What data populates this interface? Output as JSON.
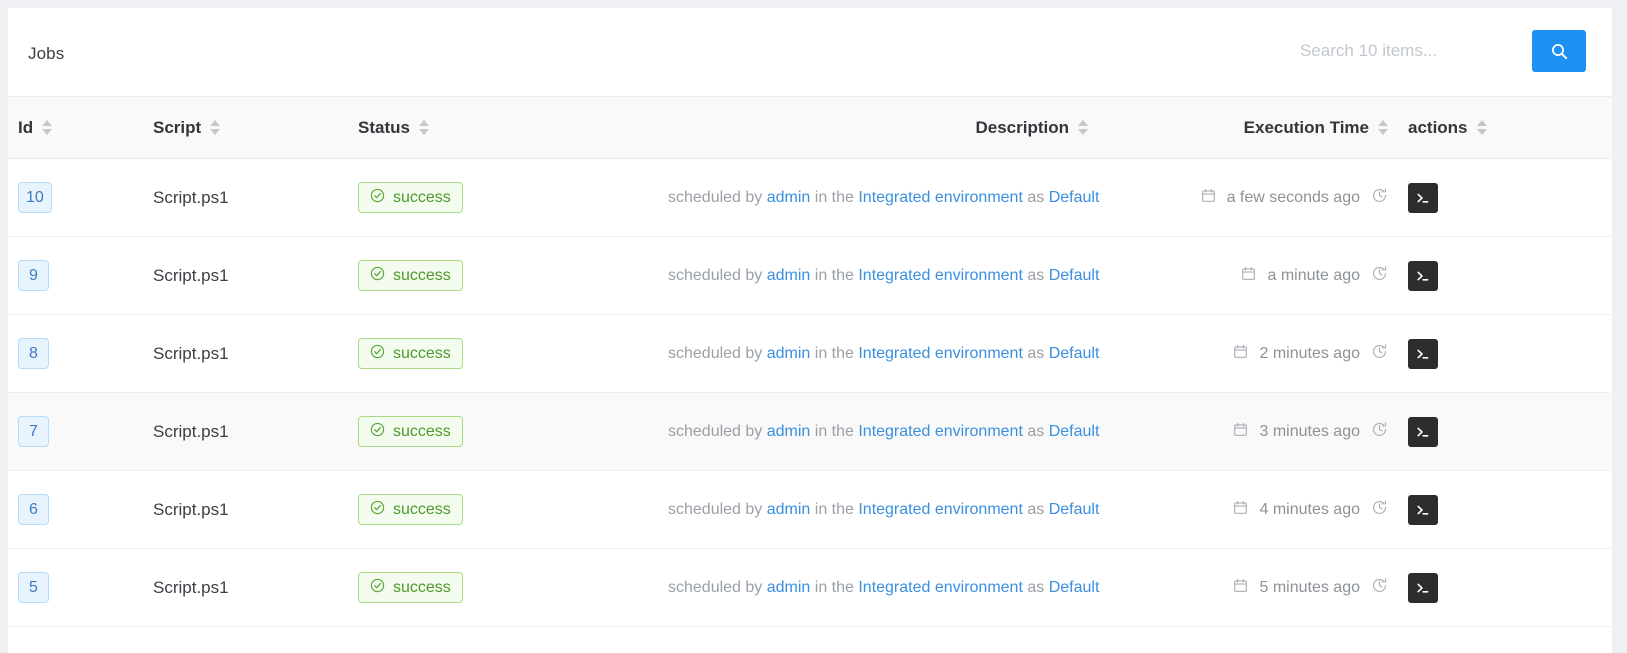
{
  "header": {
    "title": "Jobs",
    "search": {
      "value": "",
      "placeholder": "Search 10 items...",
      "button_icon": "search-icon"
    },
    "accent_color": "#1d90f4"
  },
  "table": {
    "columns": [
      {
        "key": "id",
        "label": "Id",
        "align": "left",
        "sortable": true
      },
      {
        "key": "script",
        "label": "Script",
        "align": "left",
        "sortable": true
      },
      {
        "key": "status",
        "label": "Status",
        "align": "left",
        "sortable": true
      },
      {
        "key": "desc",
        "label": "Description",
        "align": "right",
        "sortable": true
      },
      {
        "key": "time",
        "label": "Execution Time",
        "align": "right",
        "sortable": true
      },
      {
        "key": "acts",
        "label": "actions",
        "align": "left",
        "sortable": true
      }
    ],
    "description_template": {
      "prefix": "scheduled by ",
      "user": "admin",
      "middle": " in the ",
      "environment": "Integrated environment",
      "suffix": " as ",
      "credential": "Default"
    },
    "status_colors": {
      "success_text": "#4c9a2a",
      "success_border": "#a8dc83",
      "success_bg": "#f4fbef"
    },
    "rows": [
      {
        "id": "10",
        "script": "Script.ps1",
        "status": "success",
        "time": "a few seconds ago",
        "hovered": false
      },
      {
        "id": "9",
        "script": "Script.ps1",
        "status": "success",
        "time": "a minute ago",
        "hovered": false
      },
      {
        "id": "8",
        "script": "Script.ps1",
        "status": "success",
        "time": "2 minutes ago",
        "hovered": false
      },
      {
        "id": "7",
        "script": "Script.ps1",
        "status": "success",
        "time": "3 minutes ago",
        "hovered": true
      },
      {
        "id": "6",
        "script": "Script.ps1",
        "status": "success",
        "time": "4 minutes ago",
        "hovered": false
      },
      {
        "id": "5",
        "script": "Script.ps1",
        "status": "success",
        "time": "5 minutes ago",
        "hovered": false
      }
    ]
  }
}
